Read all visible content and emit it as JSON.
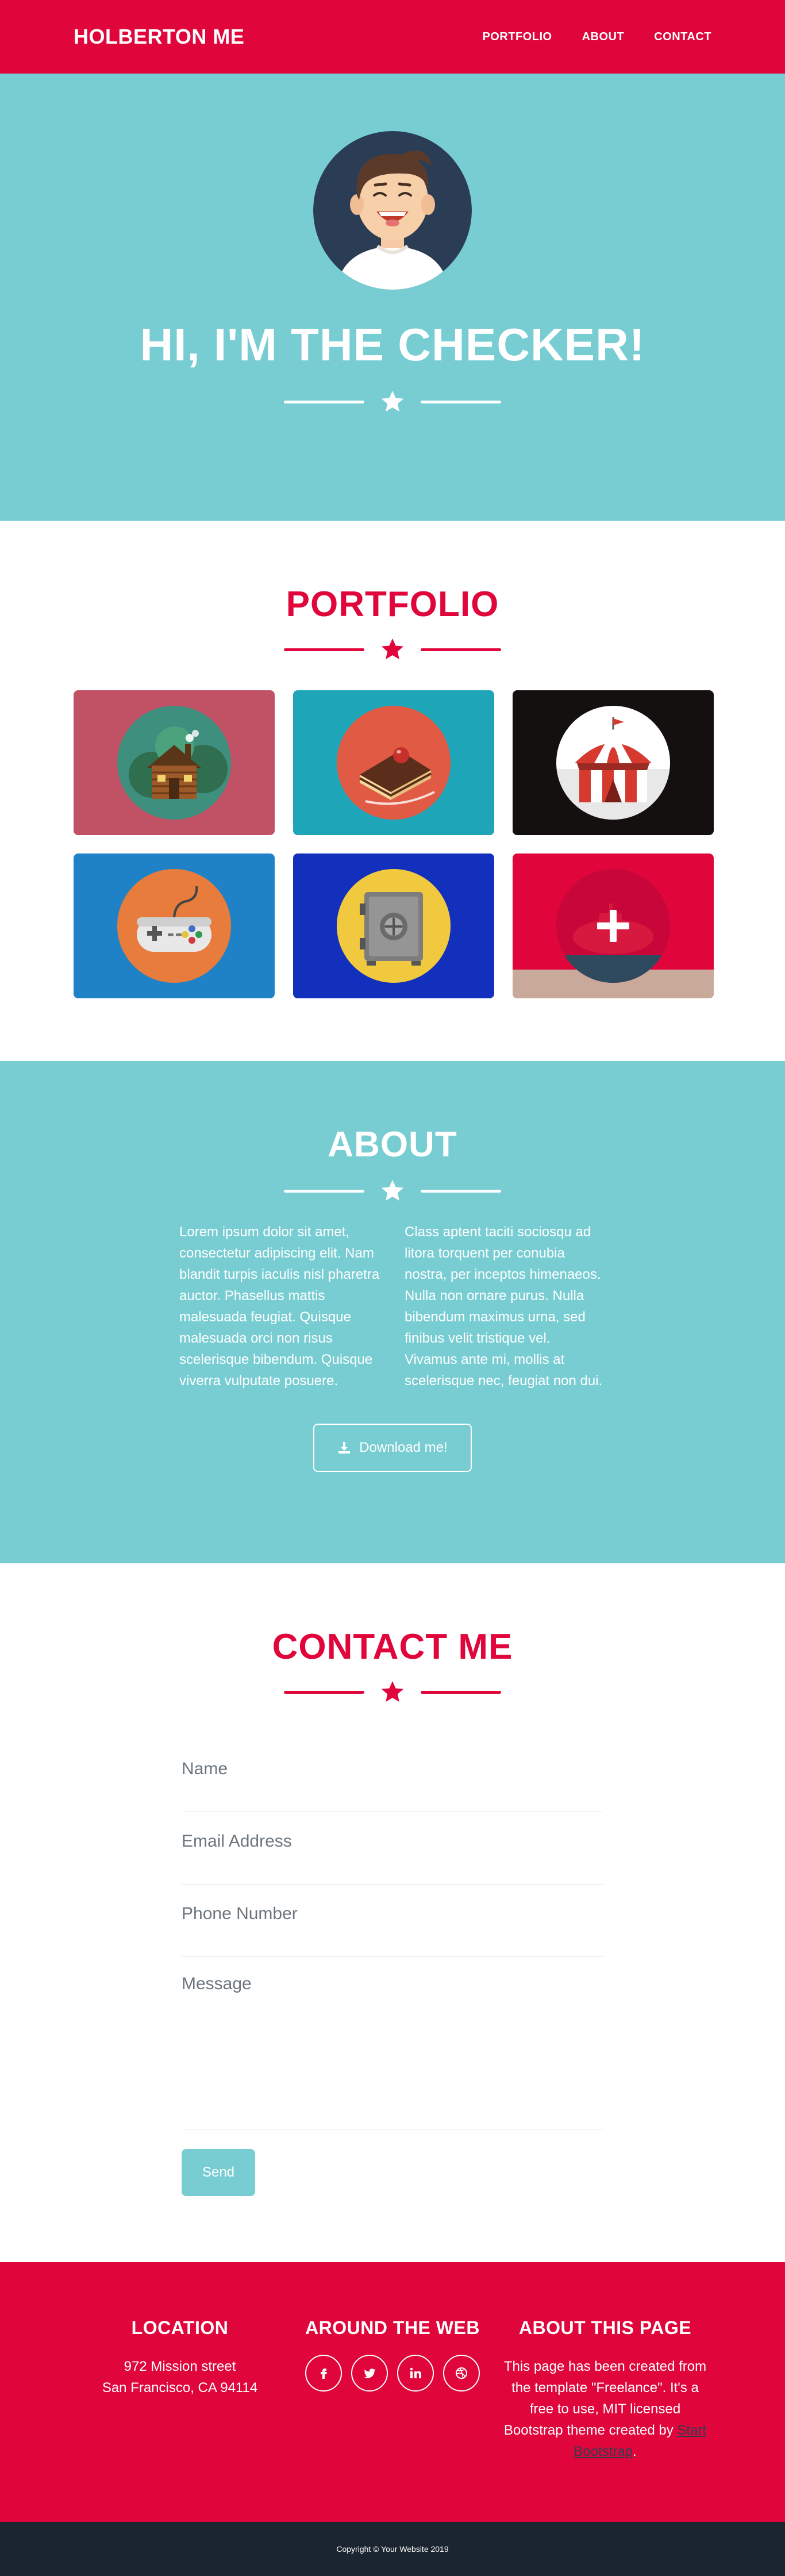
{
  "nav": {
    "brand": "HOLBERTON ME",
    "links": [
      "PORTFOLIO",
      "ABOUT",
      "CONTACT"
    ]
  },
  "masthead": {
    "title": "HI, I'M THE CHECKER!"
  },
  "portfolio": {
    "title": "PORTFOLIO",
    "items": [
      {
        "icon": "cabin-icon",
        "bg": "#c15265",
        "circle": "#3f8f7f"
      },
      {
        "icon": "cake-icon",
        "bg": "#1fa5b8",
        "circle": "#e15a43"
      },
      {
        "icon": "circus-tent-icon",
        "bg": "#141010",
        "circle": "#ffffff"
      },
      {
        "icon": "game-controller-icon",
        "bg": "#2082c6",
        "circle": "#e77c3d"
      },
      {
        "icon": "safe-icon",
        "bg": "#1330bd",
        "circle": "#f1c93e"
      },
      {
        "icon": "submarine-icon",
        "bg": "#e0063c",
        "circle": "#e0063c"
      }
    ]
  },
  "about": {
    "title": "ABOUT",
    "left": "Lorem ipsum dolor sit amet, consectetur adipiscing elit. Nam blandit turpis iaculis nisl pharetra auctor. Phasellus mattis malesuada feugiat. Quisque malesuada orci non risus scelerisque bibendum. Quisque viverra vulputate posuere.",
    "right": "Class aptent taciti sociosqu ad litora torquent per conubia nostra, per inceptos himenaeos. Nulla non ornare purus. Nulla bibendum maximus urna, sed finibus velit tristique vel. Vivamus ante mi, mollis at scelerisque nec, feugiat non dui.",
    "download_label": "Download me!"
  },
  "contact": {
    "title": "CONTACT ME",
    "name_placeholder": "Name",
    "email_placeholder": "Email Address",
    "phone_placeholder": "Phone Number",
    "message_placeholder": "Message",
    "send_label": "Send"
  },
  "footer": {
    "location_title": "LOCATION",
    "address_line1": "972 Mission street",
    "address_line2": "San Francisco, CA 94114",
    "web_title": "AROUND THE WEB",
    "socials": [
      {
        "icon": "facebook-icon",
        "glyph": "f"
      },
      {
        "icon": "twitter-icon",
        "glyph": "t"
      },
      {
        "icon": "linkedin-icon",
        "glyph": "in"
      },
      {
        "icon": "dribbble-icon",
        "glyph": "◎"
      }
    ],
    "about_title": "ABOUT THIS PAGE",
    "about_text": "This page has been created from the template \"Freelance\". It's a free to use, MIT licensed Bootstrap theme created by",
    "about_link": "Start Bootstrap",
    "about_tail": "."
  },
  "copyright": "Copyright © Your Website 2019",
  "colors": {
    "primary": "#e0063c",
    "secondary": "#78cdd3",
    "dark": "#1a252f"
  }
}
